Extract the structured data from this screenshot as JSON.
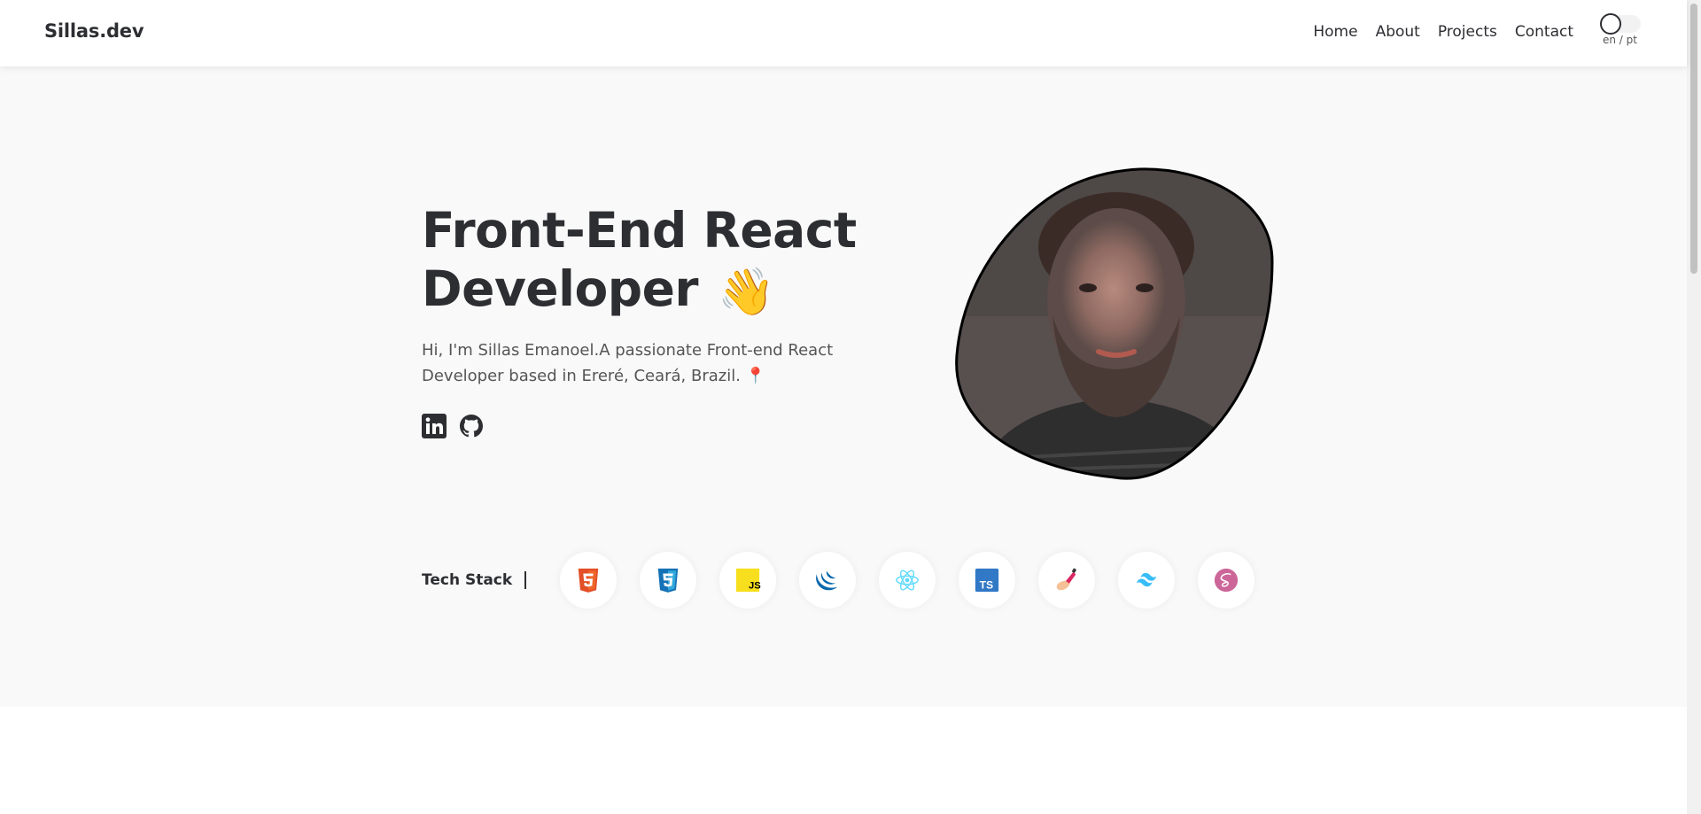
{
  "header": {
    "logo": "Sillas.dev",
    "nav": [
      "Home",
      "About",
      "Projects",
      "Contact"
    ],
    "lang_toggle_label": "en / pt"
  },
  "hero": {
    "title_line1": "Front-End React",
    "title_line2": "Developer",
    "wave_emoji": "👋",
    "description": "Hi, I'm Sillas Emanoel.A passionate Front-end React Developer based in Ereré, Ceará, Brazil.",
    "location_pin": "📍",
    "social": [
      "linkedin-icon",
      "github-icon"
    ]
  },
  "tech_stack": {
    "label": "Tech Stack",
    "icons": [
      "html5-icon",
      "css3-icon",
      "javascript-icon",
      "jquery-icon",
      "react-icon",
      "typescript-icon",
      "styled-components-icon",
      "tailwind-icon",
      "sass-icon"
    ]
  },
  "colors": {
    "text": "#2d2e32",
    "hero_bg": "#f9f9f9",
    "html5": "#e34f26",
    "css3": "#1572b6",
    "javascript": "#f7df1e",
    "react": "#61dafb",
    "typescript": "#3178c6",
    "tailwind": "#38bdf8",
    "sass": "#cc6699"
  }
}
